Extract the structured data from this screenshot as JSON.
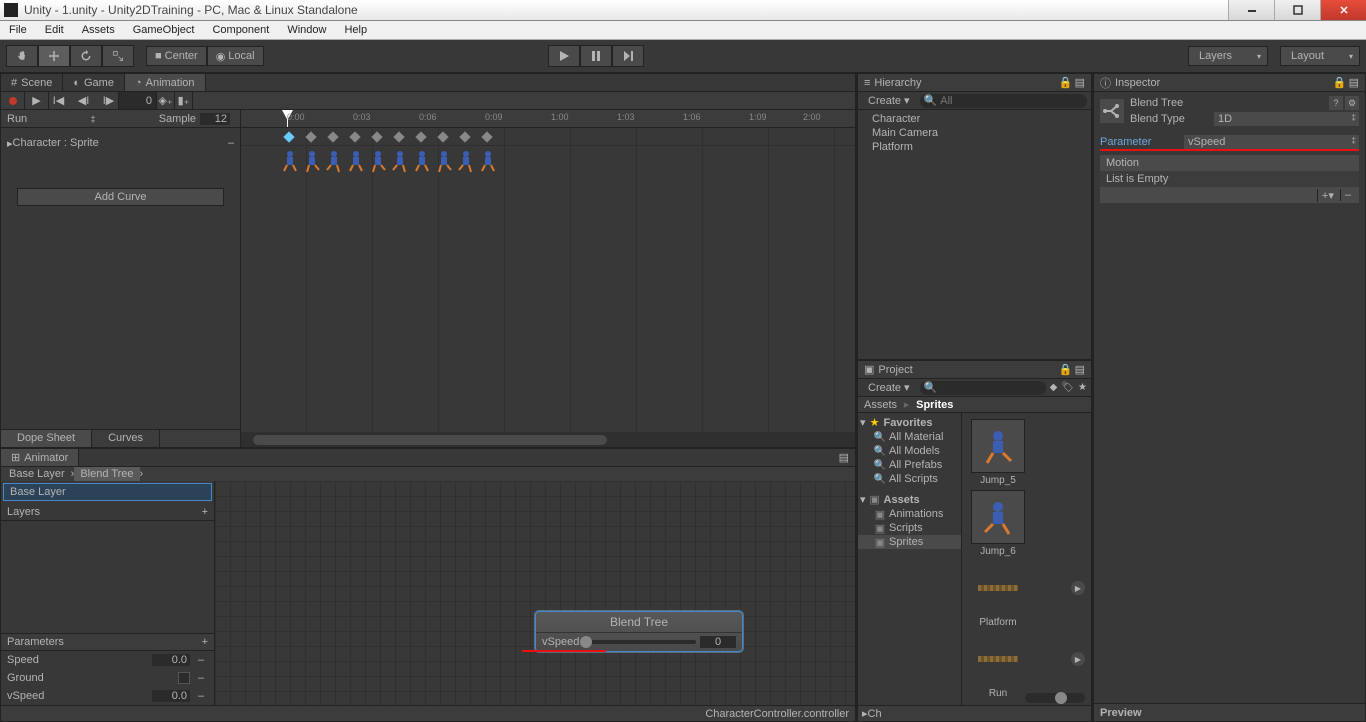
{
  "window": {
    "title": "Unity - 1.unity - Unity2DTraining - PC, Mac & Linux Standalone"
  },
  "menu": {
    "items": [
      "File",
      "Edit",
      "Assets",
      "GameObject",
      "Component",
      "Window",
      "Help"
    ]
  },
  "toolbar": {
    "pivot_mode": "Center",
    "coord_mode": "Local",
    "layers_label": "Layers",
    "layout_label": "Layout"
  },
  "anim_tabs": {
    "scene": "Scene",
    "game": "Game",
    "animation": "Animation"
  },
  "anim_toolbar": {
    "frame_num": "0",
    "sample_label": "Sample",
    "sample_val": "12",
    "mode": "Run"
  },
  "anim_track": {
    "name": "Character : Sprite"
  },
  "add_curve": "Add Curve",
  "anim_bottom": {
    "dope": "Dope Sheet",
    "curves": "Curves"
  },
  "time_ticks": [
    "0:00",
    "0:03",
    "0:06",
    "0:09",
    "1:00",
    "1:03",
    "1:06",
    "1:09",
    "2:00"
  ],
  "animator": {
    "tab": "Animator",
    "crumbs": [
      "Base Layer",
      "Blend Tree"
    ],
    "base_layer": "Base Layer",
    "layers_label": "Layers",
    "params_label": "Parameters",
    "params": [
      {
        "name": "Speed",
        "val": "0.0",
        "type": "float"
      },
      {
        "name": "Ground",
        "val": "",
        "type": "bool"
      },
      {
        "name": "vSpeed",
        "val": "0.0",
        "type": "float"
      }
    ],
    "node_title": "Blend Tree",
    "node_param": "vSpeed",
    "node_val": "0",
    "status": "CharacterController.controller"
  },
  "hierarchy": {
    "title": "Hierarchy",
    "create": "Create",
    "search_ph": "All",
    "items": [
      "Character",
      "Main Camera",
      "Platform"
    ]
  },
  "project": {
    "title": "Project",
    "create": "Create",
    "favorites": "Favorites",
    "fav_items": [
      "All Material",
      "All Models",
      "All Prefabs",
      "All Scripts"
    ],
    "assets_root": "Assets",
    "asset_folders": [
      "Animations",
      "Scripts",
      "Sprites"
    ],
    "crumb_root": "Assets",
    "crumb_leaf": "Sprites",
    "grid_items": [
      "Jump_5",
      "Jump_6",
      "Platform",
      "Run"
    ]
  },
  "inspector": {
    "title": "Inspector",
    "asset_name": "Blend Tree",
    "blend_type_label": "Blend Type",
    "blend_type_val": "1D",
    "parameter_label": "Parameter",
    "parameter_val": "vSpeed",
    "motion_label": "Motion",
    "list_empty": "List is Empty",
    "preview": "Preview"
  }
}
